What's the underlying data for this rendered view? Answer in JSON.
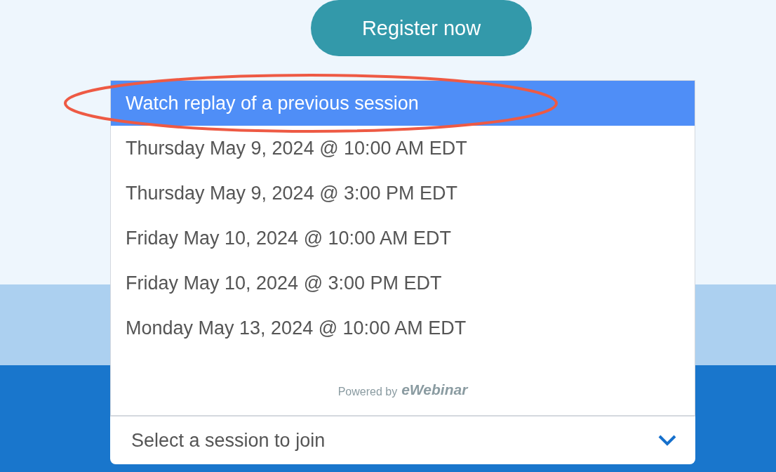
{
  "register_button": {
    "label": "Register now"
  },
  "session_dropdown": {
    "options": [
      {
        "label": "Watch replay of a previous session",
        "selected": true
      },
      {
        "label": "Thursday May 9, 2024 @ 10:00 AM EDT",
        "selected": false
      },
      {
        "label": "Thursday May 9, 2024 @ 3:00 PM EDT",
        "selected": false
      },
      {
        "label": "Friday May 10, 2024 @ 10:00 AM EDT",
        "selected": false
      },
      {
        "label": "Friday May 10, 2024 @ 3:00 PM EDT",
        "selected": false
      },
      {
        "label": "Monday May 13, 2024 @ 10:00 AM EDT",
        "selected": false
      }
    ],
    "powered_by": {
      "label": "Powered by",
      "brand": "eWebinar"
    },
    "placeholder": "Select a session to join",
    "expanded": true
  },
  "annotation": {
    "kind": "ellipse"
  }
}
